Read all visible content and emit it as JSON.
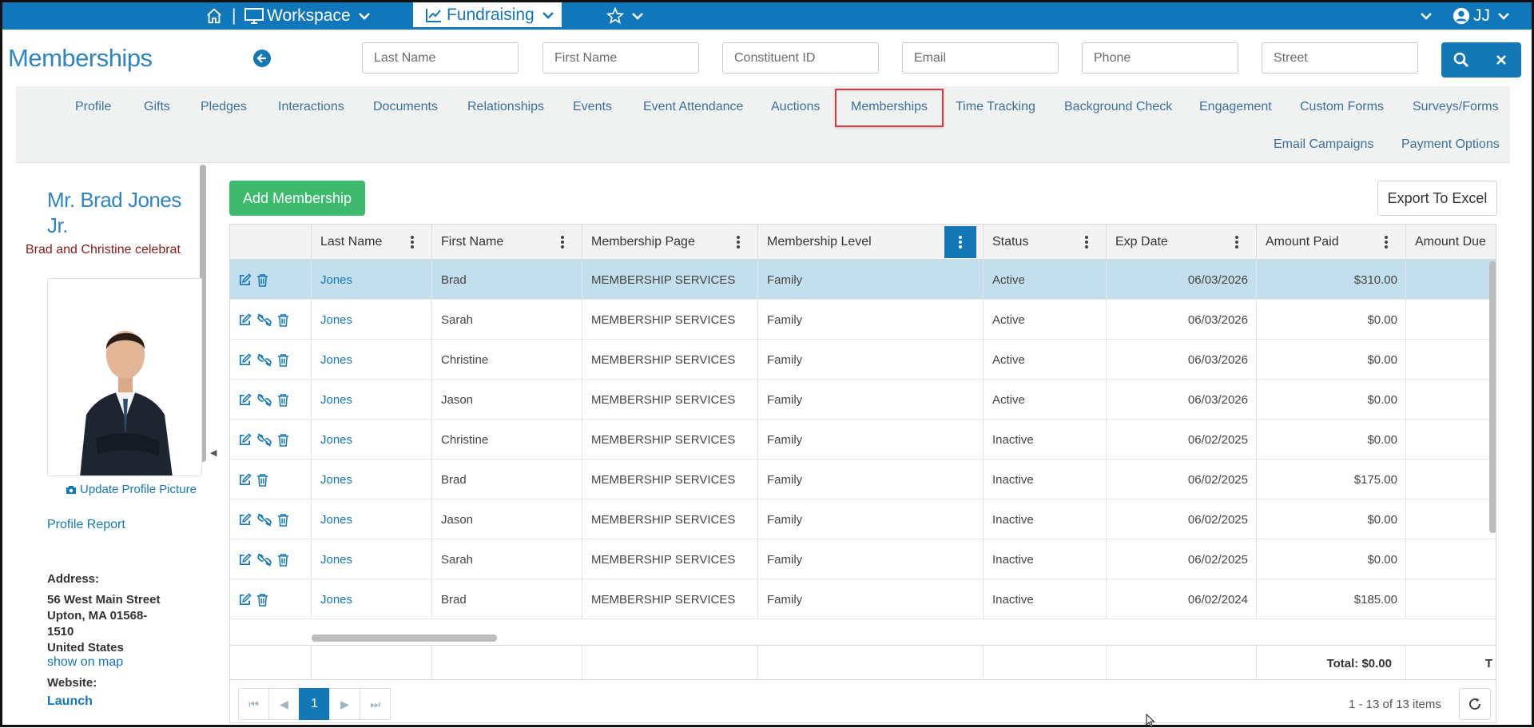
{
  "colors": {
    "brand": "#0f77ba",
    "link": "#1478b6",
    "add": "#3dba6d",
    "selected_row": "#c3deed",
    "active_tab_border": "#e0393e"
  },
  "topnav": {
    "home_icon": "home-icon",
    "separator": "|",
    "workspace_label": "Workspace",
    "fundraising_label": "Fundraising",
    "favorites_icon": "star-icon",
    "user_initials": "JJ"
  },
  "page_title": "Memberships",
  "search": {
    "last_name": "Last Name",
    "first_name": "First Name",
    "constituent_id": "Constituent ID",
    "email": "Email",
    "phone": "Phone",
    "street": "Street"
  },
  "tabs": {
    "profile": "Profile",
    "gifts": "Gifts",
    "pledges": "Pledges",
    "interactions": "Interactions",
    "documents": "Documents",
    "relationships": "Relationships",
    "events": "Events",
    "event_attendance": "Event Attendance",
    "auctions": "Auctions",
    "memberships": "Memberships",
    "time_tracking": "Time Tracking",
    "background_check": "Background Check",
    "engagement": "Engagement",
    "custom_forms": "Custom Forms",
    "surveys_forms": "Surveys/Forms",
    "email_campaigns": "Email Campaigns",
    "payment_options": "Payment Options"
  },
  "profile": {
    "name_line1": "Mr. Brad Jones",
    "name_line2": "Jr.",
    "subtitle": "Brad and Christine celebrat",
    "update_picture": "Update Profile Picture",
    "profile_report": "Profile Report",
    "address_label": "Address:",
    "address_line1": "56 West Main Street",
    "address_line2": "Upton, MA 01568-",
    "address_line3": "1510",
    "address_line4": "United States",
    "show_on_map": "show on map",
    "website_label": "Website:",
    "launch": "Launch"
  },
  "toolbar": {
    "add_membership": "Add Membership",
    "export_excel": "Export To Excel"
  },
  "grid": {
    "columns": {
      "last_name": "Last Name",
      "first_name": "First Name",
      "membership_page": "Membership Page",
      "membership_level": "Membership Level",
      "status": "Status",
      "exp_date": "Exp Date",
      "amount_paid": "Amount Paid",
      "amount_due": "Amount Due"
    },
    "rows": [
      {
        "last": "Jones",
        "first": "Brad",
        "page": "MEMBERSHIP SERVICES",
        "level": "Family",
        "status": "Active",
        "exp": "06/03/2026",
        "paid": "$310.00",
        "unlink": false
      },
      {
        "last": "Jones",
        "first": "Sarah",
        "page": "MEMBERSHIP SERVICES",
        "level": "Family",
        "status": "Active",
        "exp": "06/03/2026",
        "paid": "$0.00",
        "unlink": true
      },
      {
        "last": "Jones",
        "first": "Christine",
        "page": "MEMBERSHIP SERVICES",
        "level": "Family",
        "status": "Active",
        "exp": "06/03/2026",
        "paid": "$0.00",
        "unlink": true
      },
      {
        "last": "Jones",
        "first": "Jason",
        "page": "MEMBERSHIP SERVICES",
        "level": "Family",
        "status": "Active",
        "exp": "06/03/2026",
        "paid": "$0.00",
        "unlink": true
      },
      {
        "last": "Jones",
        "first": "Christine",
        "page": "MEMBERSHIP SERVICES",
        "level": "Family",
        "status": "Inactive",
        "exp": "06/02/2025",
        "paid": "$0.00",
        "unlink": true
      },
      {
        "last": "Jones",
        "first": "Brad",
        "page": "MEMBERSHIP SERVICES",
        "level": "Family",
        "status": "Inactive",
        "exp": "06/02/2025",
        "paid": "$175.00",
        "unlink": false
      },
      {
        "last": "Jones",
        "first": "Jason",
        "page": "MEMBERSHIP SERVICES",
        "level": "Family",
        "status": "Inactive",
        "exp": "06/02/2025",
        "paid": "$0.00",
        "unlink": true
      },
      {
        "last": "Jones",
        "first": "Sarah",
        "page": "MEMBERSHIP SERVICES",
        "level": "Family",
        "status": "Inactive",
        "exp": "06/02/2025",
        "paid": "$0.00",
        "unlink": true
      },
      {
        "last": "Jones",
        "first": "Brad",
        "page": "MEMBERSHIP SERVICES",
        "level": "Family",
        "status": "Inactive",
        "exp": "06/02/2024",
        "paid": "$185.00",
        "unlink": false
      }
    ],
    "total_paid": "Total: $0.00",
    "total_due_partial": "T"
  },
  "pager": {
    "current_page": "1",
    "items_info": "1 - 13 of 13 items"
  }
}
